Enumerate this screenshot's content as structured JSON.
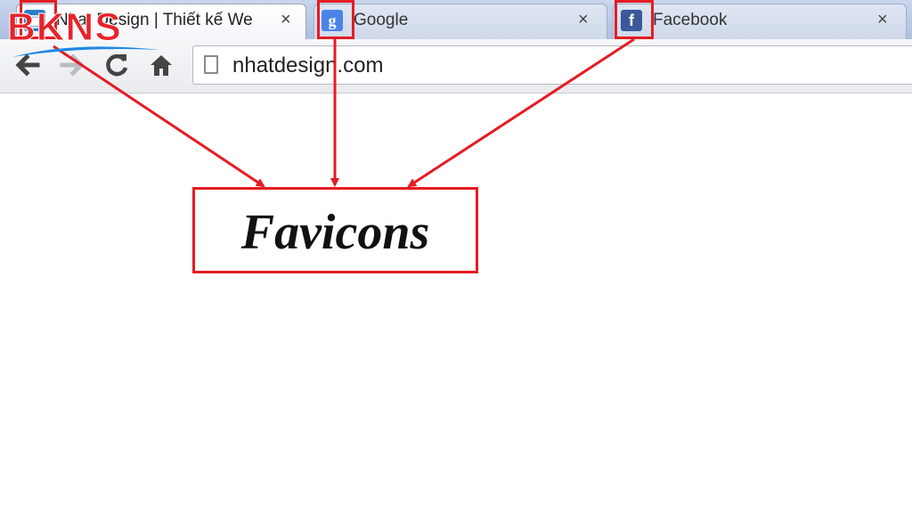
{
  "tabs": [
    {
      "title": "Nhat Design | Thiết kế We",
      "favicon": "nhatdesign-favicon",
      "active": true,
      "close": "×"
    },
    {
      "title": "Google",
      "favicon": "google-favicon",
      "favicon_glyph": "g",
      "active": false,
      "close": "×"
    },
    {
      "title": "Facebook",
      "favicon": "facebook-favicon",
      "favicon_glyph": "f",
      "active": false,
      "close": "×"
    }
  ],
  "toolbar": {
    "back_icon": "back-arrow-icon",
    "forward_icon": "forward-arrow-icon",
    "reload_icon": "reload-icon",
    "home_icon": "home-icon",
    "url": "nhatdesign.com"
  },
  "annotation": {
    "label": "Favicons",
    "color": "#e51c23"
  },
  "logo": {
    "text": "BKNS",
    "color": "#e8232a",
    "swoosh_color": "#1e88e5"
  }
}
